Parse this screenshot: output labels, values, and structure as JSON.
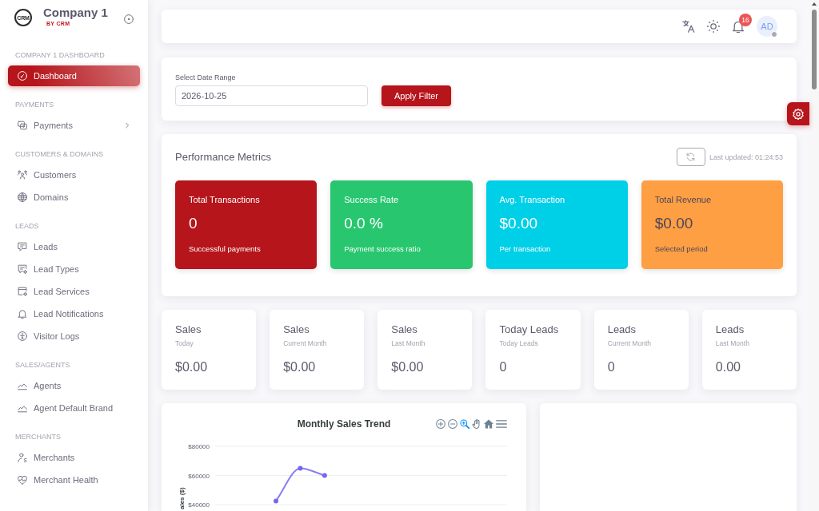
{
  "sidebar": {
    "brand": {
      "logo_text": "CRM",
      "name": "Company 1",
      "tagline": "BY CRM"
    },
    "sections": [
      {
        "title": "COMPANY 1 DASHBOARD",
        "items": [
          {
            "label": "Dashboard",
            "kind": "link",
            "selected": true
          }
        ]
      },
      {
        "title": "PAYMENTS",
        "items": [
          {
            "label": "Payments",
            "kind": "submenu",
            "selected": false
          }
        ]
      },
      {
        "title": "CUSTOMERS & DOMAINS",
        "items": [
          {
            "label": "Customers",
            "kind": "link",
            "selected": false
          },
          {
            "label": "Domains",
            "kind": "link",
            "selected": false
          }
        ]
      },
      {
        "title": "LEADS",
        "items": [
          {
            "label": "Leads",
            "kind": "link",
            "selected": false
          },
          {
            "label": "Lead Types",
            "kind": "link",
            "selected": false
          },
          {
            "label": "Lead Services",
            "kind": "link",
            "selected": false
          },
          {
            "label": "Lead Notifications",
            "kind": "link",
            "selected": false
          },
          {
            "label": "Visitor Logs",
            "kind": "link",
            "selected": false
          }
        ]
      },
      {
        "title": "SALES/AGENTS",
        "items": [
          {
            "label": "Agents",
            "kind": "link",
            "selected": false
          },
          {
            "label": "Agent Default Brand",
            "kind": "link",
            "selected": false
          }
        ]
      },
      {
        "title": "MERCHANTS",
        "items": [
          {
            "label": "Merchants",
            "kind": "link",
            "selected": false
          },
          {
            "label": "Merchant Health",
            "kind": "link",
            "selected": false
          }
        ]
      }
    ]
  },
  "topbar": {
    "notification_count": "16",
    "avatar": {
      "initials": "AD",
      "online": false
    }
  },
  "filter": {
    "label": "Select Date Range",
    "date": "2026-10-25",
    "apply_button": "Apply Filter"
  },
  "performance": {
    "title": "Performance Metrics",
    "last_updated": "Last updated: 01:24:53",
    "cards": [
      {
        "title": "Total Transactions",
        "value": "0",
        "caption": "Successful payments",
        "color": "#b5151b"
      },
      {
        "title": "Success Rate",
        "value": "0.0 %",
        "caption": "Payment success ratio",
        "color": "#28c76f"
      },
      {
        "title": "Avg. Transaction",
        "value": "$0.00",
        "caption": "Per transaction",
        "color": "#00cfe8"
      },
      {
        "title": "Total Revenue",
        "value": "$0.00",
        "caption": "Selected period",
        "color": "#ff9f43"
      }
    ]
  },
  "stats": [
    {
      "title": "Sales",
      "subtitle": "Today",
      "value": "$0.00"
    },
    {
      "title": "Sales",
      "subtitle": "Current Month",
      "value": "$0.00"
    },
    {
      "title": "Sales",
      "subtitle": "Last Month",
      "value": "$0.00"
    },
    {
      "title": "Today Leads",
      "subtitle": "Today Leads",
      "value": "0"
    },
    {
      "title": "Leads",
      "subtitle": "Current Month",
      "value": "0"
    },
    {
      "title": "Leads",
      "subtitle": "Last Month",
      "value": "0.00"
    }
  ],
  "sales_chart": {
    "selection_tools": [
      {
        "selected": true
      },
      {
        "selected": false
      }
    ],
    "chart_data": {
      "type": "line",
      "title": "Monthly Sales Trend",
      "ylabel": "ales ($)",
      "categories": [
        null,
        null,
        null,
        null,
        null,
        null,
        null,
        null,
        null,
        null,
        null,
        null
      ],
      "ylim": [
        40000,
        80000
      ],
      "yticks": [
        {
          "value": 80000,
          "label": "$80000"
        },
        {
          "value": 60000,
          "label": "$60000"
        },
        {
          "value": 40000,
          "label": "$40000"
        }
      ],
      "series": [
        {
          "color": "#7367f0",
          "marker": "circle",
          "values": [
            null,
            null,
            42500,
            65000,
            60000,
            null,
            null,
            null,
            null,
            null,
            null,
            null
          ]
        }
      ]
    }
  }
}
